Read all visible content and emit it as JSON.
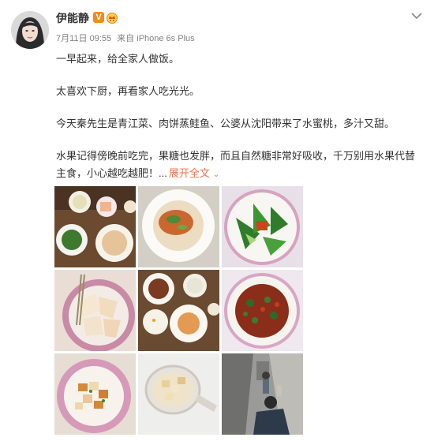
{
  "post": {
    "username": "伊能静",
    "verified_badge": "V",
    "timestamp": "7月11日 09:55",
    "source_prefix": "来自",
    "source_device": "iPhone 6s Plus",
    "paragraphs": [
      "一早起来，给全家人做饭。",
      "太喜欢下厨，再看家人吃光光。",
      "今天秦先生是青江菜、肉饼蒸鲑鱼、公婆从沈阳带来了水蜜桃，多汁又甜。",
      "水果记得傍晚前吃完，果糖也发胖，而且自然糖非常好吸收，千万别用水果代替主食，小心越吃越肥！..."
    ],
    "expand_label": "展开全文",
    "colors": {
      "link": "#eb7350",
      "meta": "#808080",
      "text": "#333333",
      "vip": "#f28a1c"
    }
  },
  "photos": [
    {
      "name": "photo-breakfast-table",
      "icon": "food-photo"
    },
    {
      "name": "photo-rice-meat-patty",
      "icon": "food-photo"
    },
    {
      "name": "photo-green-vegetables",
      "icon": "food-photo"
    },
    {
      "name": "photo-peaches-plate",
      "icon": "food-photo"
    },
    {
      "name": "photo-meal-overview",
      "icon": "food-photo"
    },
    {
      "name": "photo-stir-fry",
      "icon": "food-photo"
    },
    {
      "name": "photo-tofu-plate",
      "icon": "food-photo"
    },
    {
      "name": "photo-tofu-bowl",
      "icon": "food-photo"
    },
    {
      "name": "photo-street-scene",
      "icon": "photo"
    }
  ]
}
